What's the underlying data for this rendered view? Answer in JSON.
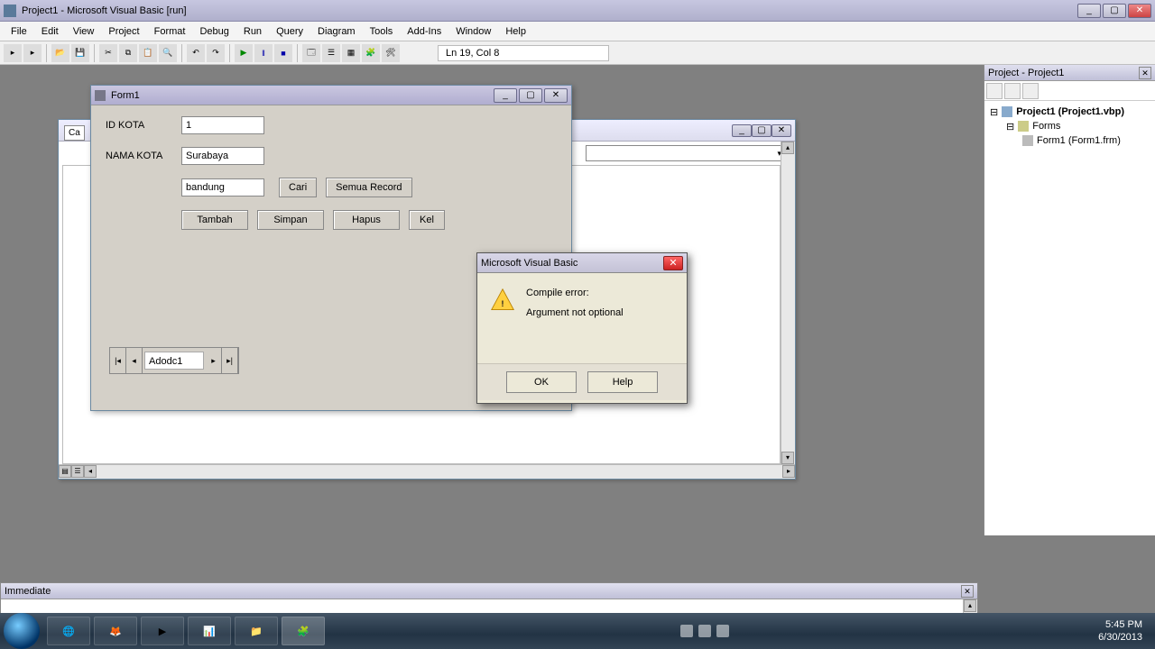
{
  "main_title": "Project1 - Microsoft Visual Basic [run]",
  "menu": [
    "File",
    "Edit",
    "View",
    "Project",
    "Format",
    "Debug",
    "Run",
    "Query",
    "Diagram",
    "Tools",
    "Add-Ins",
    "Window",
    "Help"
  ],
  "status_pos": "Ln 19, Col 8",
  "project_panel": {
    "title": "Project - Project1",
    "root": "Project1 (Project1.vbp)",
    "folder": "Forms",
    "item": "Form1 (Form1.frm)"
  },
  "immediate_title": "Immediate",
  "form1": {
    "title": "Form1",
    "label_id": "ID KOTA",
    "label_nama": "NAMA KOTA",
    "val_id": "1",
    "val_nama": "Surabaya",
    "val_search": "bandung",
    "btn_cari": "Cari",
    "btn_semua": "Semua Record",
    "btn_tambah": "Tambah",
    "btn_simpan": "Simpan",
    "btn_hapus": "Hapus",
    "btn_keluar": "Kel",
    "adodc": "Adodc1"
  },
  "code_bg_tab": "Ca",
  "msgbox": {
    "title": "Microsoft Visual Basic",
    "line1": "Compile error:",
    "line2": "Argument not optional",
    "ok": "OK",
    "help": "Help"
  },
  "tray": {
    "time": "5:45 PM",
    "date": "6/30/2013"
  }
}
